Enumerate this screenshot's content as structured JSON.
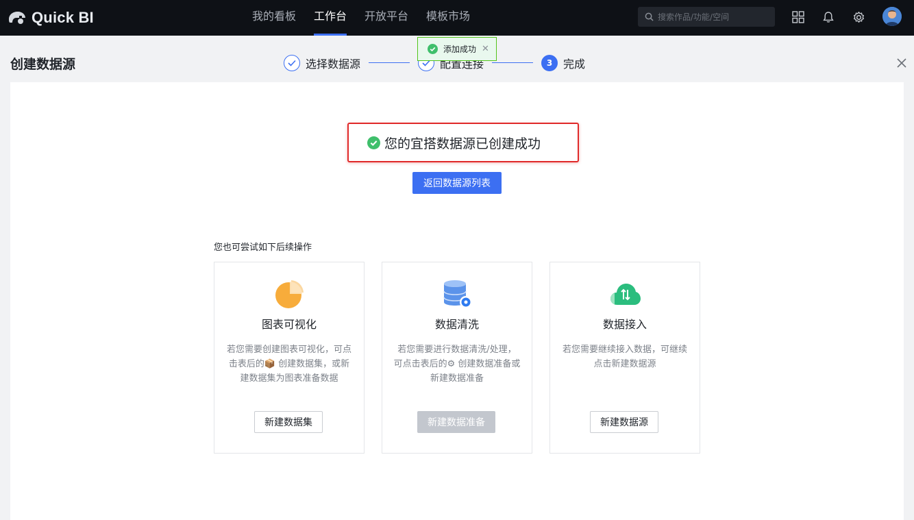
{
  "app": {
    "logo_text": "Quick BI"
  },
  "nav": {
    "items": [
      "我的看板",
      "工作台",
      "开放平台",
      "模板市场"
    ],
    "active_index": 1
  },
  "search": {
    "placeholder": "搜索作品/功能/空间"
  },
  "toast": {
    "text": "添加成功"
  },
  "page": {
    "title": "创建数据源"
  },
  "steps": [
    {
      "label": "选择数据源",
      "state": "done"
    },
    {
      "label": "配置连接",
      "state": "done"
    },
    {
      "number": "3",
      "label": "完成",
      "state": "current"
    }
  ],
  "result": {
    "message": "您的宜搭数据源已创建成功",
    "back_button": "返回数据源列表"
  },
  "suggestions": {
    "title": "您也可尝试如下后续操作",
    "cards": [
      {
        "title": "图表可视化",
        "desc": "若您需要创建图表可视化，可点击表后的📦 创建数据集，或新建数据集为图表准备数据",
        "button": "新建数据集",
        "enabled": true
      },
      {
        "title": "数据清洗",
        "desc": "若您需要进行数据清洗/处理，可点击表后的⚙ 创建数据准备或新建数据准备",
        "button": "新建数据准备",
        "enabled": false
      },
      {
        "title": "数据接入",
        "desc": "若您需要继续接入数据，可继续点击新建数据源",
        "button": "新建数据源",
        "enabled": true
      }
    ]
  },
  "colors": {
    "primary": "#3c6ff2",
    "success": "#3fbf6b",
    "highlight_border": "#e02a2a",
    "topbar": "#0e1116"
  }
}
